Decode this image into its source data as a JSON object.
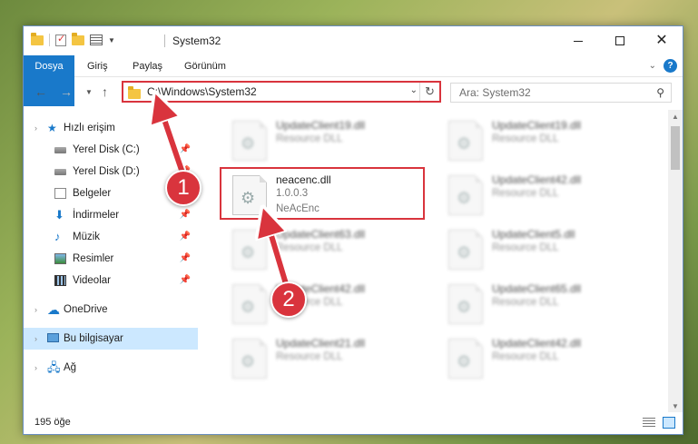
{
  "window": {
    "title": "System32",
    "colors": {
      "accent": "#1979ca",
      "highlight": "#d9343d",
      "selected": "#cce8ff"
    }
  },
  "ribbon": {
    "tabs": [
      "Dosya",
      "Giriş",
      "Paylaş",
      "Görünüm"
    ]
  },
  "address": {
    "path": "C:\\Windows\\System32",
    "search_placeholder": "Ara: System32"
  },
  "sidebar": {
    "items": [
      {
        "label": "Hızlı erişim",
        "icon": "star-icon"
      },
      {
        "label": "Yerel Disk (C:)",
        "icon": "disk-icon",
        "pinned": true
      },
      {
        "label": "Yerel Disk (D:)",
        "icon": "disk-icon",
        "pinned": true
      },
      {
        "label": "Belgeler",
        "icon": "documents-icon",
        "pinned": true
      },
      {
        "label": "İndirmeler",
        "icon": "downloads-icon",
        "pinned": true
      },
      {
        "label": "Müzik",
        "icon": "music-icon",
        "pinned": true
      },
      {
        "label": "Resimler",
        "icon": "pictures-icon",
        "pinned": true
      },
      {
        "label": "Videolar",
        "icon": "videos-icon",
        "pinned": true
      },
      {
        "label": "OneDrive",
        "icon": "cloud-icon"
      },
      {
        "label": "Bu bilgisayar",
        "icon": "computer-icon",
        "selected": true
      },
      {
        "label": "Ağ",
        "icon": "network-icon"
      }
    ]
  },
  "files": [
    {
      "name": "UpdateClient19.dll",
      "line1": "Resource DLL",
      "line2": ""
    },
    {
      "name": "UpdateClient19.dll",
      "line1": "Resource DLL",
      "line2": ""
    },
    {
      "name": "neacenc.dll",
      "line1": "1.0.0.3",
      "line2": "NeAcEnc"
    },
    {
      "name": "UpdateClient42.dll",
      "line1": "Resource DLL",
      "line2": ""
    },
    {
      "name": "UpdateClient63.dll",
      "line1": "Resource DLL",
      "line2": ""
    },
    {
      "name": "UpdateClient5.dll",
      "line1": "Resource DLL",
      "line2": ""
    },
    {
      "name": "UpdateClient42.dll",
      "line1": "Resource DLL",
      "line2": ""
    },
    {
      "name": "UpdateClient65.dll",
      "line1": "Resource DLL",
      "line2": ""
    },
    {
      "name": "UpdateClient21.dll",
      "line1": "Resource DLL",
      "line2": ""
    },
    {
      "name": "UpdateClient42.dll",
      "line1": "Resource DLL",
      "line2": ""
    }
  ],
  "status": {
    "item_count": "195 öğe"
  },
  "callouts": [
    "1",
    "2"
  ]
}
